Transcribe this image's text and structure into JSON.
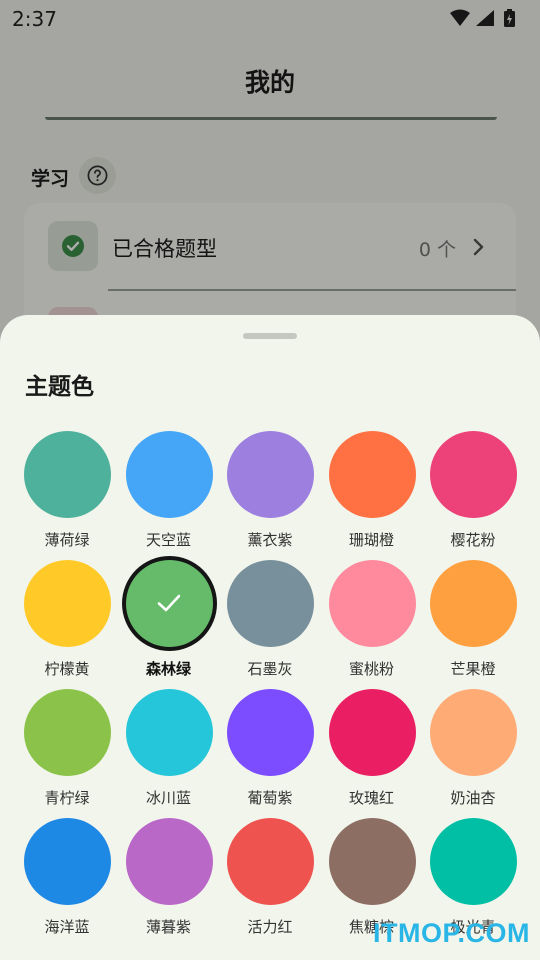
{
  "status_bar": {
    "time": "2:37"
  },
  "header": {
    "title": "我的"
  },
  "study_section": {
    "title": "学习",
    "items": [
      {
        "label": "已合格题型",
        "count": "0 个"
      }
    ]
  },
  "theme_sheet": {
    "title": "主题色",
    "selected": "森林绿",
    "colors": [
      {
        "name": "薄荷绿",
        "hex": "#4db19c"
      },
      {
        "name": "天空蓝",
        "hex": "#45a5f7"
      },
      {
        "name": "薰衣紫",
        "hex": "#9c7fdf"
      },
      {
        "name": "珊瑚橙",
        "hex": "#ff7043"
      },
      {
        "name": "樱花粉",
        "hex": "#ed417a"
      },
      {
        "name": "柠檬黄",
        "hex": "#ffca28"
      },
      {
        "name": "森林绿",
        "hex": "#66bb6a"
      },
      {
        "name": "石墨灰",
        "hex": "#78909c"
      },
      {
        "name": "蜜桃粉",
        "hex": "#ff8a9e"
      },
      {
        "name": "芒果橙",
        "hex": "#ffa040"
      },
      {
        "name": "青柠绿",
        "hex": "#8bc34a"
      },
      {
        "name": "冰川蓝",
        "hex": "#26c6da"
      },
      {
        "name": "葡萄紫",
        "hex": "#7c4dff"
      },
      {
        "name": "玫瑰红",
        "hex": "#e91e63"
      },
      {
        "name": "奶油杏",
        "hex": "#ffab76"
      },
      {
        "name": "海洋蓝",
        "hex": "#1e88e5"
      },
      {
        "name": "薄暮紫",
        "hex": "#ba68c8"
      },
      {
        "name": "活力红",
        "hex": "#ef5350"
      },
      {
        "name": "焦糖棕",
        "hex": "#8d6e63"
      },
      {
        "name": "极光青",
        "hex": "#00bfa5"
      }
    ]
  },
  "watermark": "ITMOP.COM"
}
